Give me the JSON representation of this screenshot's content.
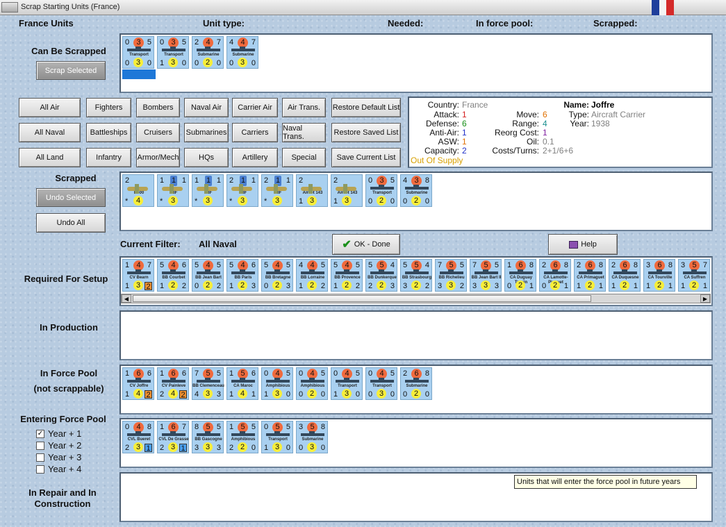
{
  "window": {
    "title": "Scrap Starting Units (France)"
  },
  "flag_colors": [
    "#1f3f9c",
    "#f4f4f4",
    "#d42a2a"
  ],
  "header": {
    "france_units": "France Units",
    "unit_type": "Unit type:",
    "needed": "Needed:",
    "in_force_pool": "In force pool:",
    "scrapped": "Scrapped:"
  },
  "sections": {
    "can_be_scrapped": "Can Be Scrapped",
    "scrapped": "Scrapped",
    "current_filter_label": "Current Filter:",
    "current_filter_value": "All Naval",
    "required": "Required For Setup",
    "in_production": "In Production",
    "in_force_pool_1": "In Force Pool",
    "in_force_pool_2": "(not scrappable)",
    "entering": "Entering Force Pool",
    "repair_1": "In Repair and In",
    "repair_2": "Construction"
  },
  "buttons": {
    "scrap_selected": "Scrap Selected",
    "undo_selected": "Undo Selected",
    "undo_all": "Undo All",
    "ok_done": "OK - Done",
    "help": "Help"
  },
  "filters": [
    [
      "All Air",
      "Fighters",
      "Bombers",
      "Naval Air",
      "Carrier Air",
      "Air Trans.",
      "Restore Default List"
    ],
    [
      "All Naval",
      "Battleships",
      "Cruisers",
      "Submarines",
      "Carriers",
      "Naval Trans.",
      "Restore Saved List"
    ],
    [
      "All Land",
      "Infantry",
      "Armor/Mech",
      "HQs",
      "Artillery",
      "Special",
      "Save Current List"
    ]
  ],
  "info": {
    "country_k": "Country:",
    "country_v": "France",
    "attack_k": "Attack:",
    "attack_v": "1",
    "defense_k": "Defense:",
    "defense_v": "6",
    "antiair_k": "Anti-Air:",
    "antiair_v": "1",
    "asw_k": "ASW:",
    "asw_v": "1",
    "capacity_k": "Capacity:",
    "capacity_v": "2",
    "supply": "Out Of Supply",
    "move_k": "Move:",
    "move_v": "6",
    "range_k": "Range:",
    "range_v": "4",
    "reorg_k": "Reorg Cost:",
    "reorg_v": "1",
    "oil_k": "Oil:",
    "oil_v": "0.1",
    "costs_k": "Costs/Turns:",
    "costs_v": "2+1/6+6",
    "name_k": "Name:",
    "name_v": "Joffre",
    "type_k": "Type:",
    "type_v": "Aircraft Carrier",
    "year_k": "Year:",
    "year_v": "1938"
  },
  "entering_checks": [
    {
      "label": "Year + 1",
      "checked": "✓"
    },
    {
      "label": "Year + 2",
      "checked": ""
    },
    {
      "label": "Year + 3",
      "checked": ""
    },
    {
      "label": "Year + 4",
      "checked": ""
    }
  ],
  "tooltip": "Units that will enter the force pool in future years",
  "can_scrap": [
    {
      "tl": "0",
      "tc": "3",
      "tr": "5",
      "nm": "Transport",
      "bl": "0",
      "bc": "3",
      "br": "0"
    },
    {
      "tl": "0",
      "tc": "3",
      "tr": "5",
      "nm": "Transport",
      "bl": "1",
      "bc": "3",
      "br": "0"
    },
    {
      "tl": "2",
      "tc": "4",
      "tr": "7",
      "nm": "Submarine",
      "bl": "0",
      "bc": "2",
      "br": "0"
    },
    {
      "tl": "4",
      "tc": "4",
      "tr": "7",
      "nm": "Submarine",
      "bl": "0",
      "bc": "3",
      "br": "0"
    }
  ],
  "scrapped_units": [
    {
      "tl": "2",
      "tc": "",
      "tr": "",
      "nm": "D500",
      "bl": "*",
      "bc": "4",
      "br": "",
      "air": true
    },
    {
      "tl": "1",
      "tc": "1",
      "tr": "1",
      "nm": "F3F",
      "bl": "*",
      "bc": "3",
      "br": "",
      "air": true
    },
    {
      "tl": "1",
      "tc": "1",
      "tr": "1",
      "nm": "F3F",
      "bl": "*",
      "bc": "3",
      "br": "",
      "air": true
    },
    {
      "tl": "2",
      "tc": "1",
      "tr": "1",
      "nm": "F3F",
      "bl": "*",
      "bc": "3",
      "br": "",
      "air": true
    },
    {
      "tl": "2",
      "tc": "1",
      "tr": "1",
      "nm": "F3F",
      "bl": "*",
      "bc": "3",
      "br": "",
      "air": true
    },
    {
      "tl": "2",
      "tc": "",
      "tr": "",
      "nm": "Amiot 143",
      "bl": "1",
      "bc": "3",
      "br": "",
      "air": true
    },
    {
      "tl": "2",
      "tc": "",
      "tr": "",
      "nm": "Amiot 143",
      "bl": "1",
      "bc": "3",
      "br": "",
      "air": true
    },
    {
      "tl": "0",
      "tc": "3",
      "tr": "5",
      "nm": "Transport",
      "bl": "0",
      "bc": "2",
      "br": "0"
    },
    {
      "tl": "4",
      "tc": "3",
      "tr": "8",
      "nm": "Submarine",
      "bl": "0",
      "bc": "2",
      "br": "0"
    }
  ],
  "required": [
    {
      "tl": "1",
      "tc": "4",
      "tr": "7",
      "nm": "CV Bearn",
      "bl": "1",
      "bc": "3",
      "bs": "2"
    },
    {
      "tl": "5",
      "tc": "4",
      "tr": "6",
      "nm": "BB Courbet",
      "bl": "1",
      "bc": "2",
      "br": "2"
    },
    {
      "tl": "5",
      "tc": "4",
      "tr": "5",
      "nm": "BB Jean Bart",
      "bl": "0",
      "bc": "2",
      "br": "2"
    },
    {
      "tl": "5",
      "tc": "4",
      "tr": "6",
      "nm": "BB Paris",
      "bl": "1",
      "bc": "2",
      "br": "3"
    },
    {
      "tl": "5",
      "tc": "4",
      "tr": "5",
      "nm": "BB Bretagne",
      "bl": "0",
      "bc": "2",
      "br": "3"
    },
    {
      "tl": "4",
      "tc": "4",
      "tr": "5",
      "nm": "BB Lorraine",
      "bl": "1",
      "bc": "2",
      "br": "2"
    },
    {
      "tl": "5",
      "tc": "4",
      "tr": "5",
      "nm": "BB Provence",
      "bl": "1",
      "bc": "2",
      "br": "2"
    },
    {
      "tl": "5",
      "tc": "5",
      "tr": "4",
      "nm": "BB Dunkerque",
      "bl": "2",
      "bc": "2",
      "br": "3"
    },
    {
      "tl": "5",
      "tc": "5",
      "tr": "4",
      "nm": "BB Strasbourg",
      "bl": "3",
      "bc": "2",
      "br": "2"
    },
    {
      "tl": "7",
      "tc": "5",
      "tr": "5",
      "nm": "BB Richelieu",
      "bl": "3",
      "bc": "3",
      "br": "2"
    },
    {
      "tl": "7",
      "tc": "5",
      "tr": "5",
      "nm": "BB Jean Bart II",
      "bl": "3",
      "bc": "3",
      "br": "3"
    },
    {
      "tl": "1",
      "tc": "6",
      "tr": "8",
      "nm": "CA Duguay Trouin",
      "bl": "0",
      "bc": "2",
      "br": "1"
    },
    {
      "tl": "2",
      "tc": "6",
      "tr": "8",
      "nm": "CA Lamotte-Picquet",
      "bl": "0",
      "bc": "2",
      "br": "1"
    },
    {
      "tl": "2",
      "tc": "6",
      "tr": "8",
      "nm": "CA Primaguet",
      "bl": "1",
      "bc": "2",
      "br": "1"
    },
    {
      "tl": "2",
      "tc": "6",
      "tr": "8",
      "nm": "CA Duquesne",
      "bl": "1",
      "bc": "2",
      "br": "1"
    },
    {
      "tl": "3",
      "tc": "6",
      "tr": "8",
      "nm": "CA Tourville",
      "bl": "1",
      "bc": "2",
      "br": "1"
    },
    {
      "tl": "3",
      "tc": "5",
      "tr": "7",
      "nm": "CA Suffren",
      "bl": "1",
      "bc": "2",
      "br": "1"
    }
  ],
  "force_pool": [
    {
      "tl": "1",
      "tc": "6",
      "tr": "6",
      "nm": "CV Joffre",
      "bl": "1",
      "bc": "4",
      "bs": "2"
    },
    {
      "tl": "1",
      "tc": "6",
      "tr": "6",
      "nm": "CV Painleve",
      "bl": "2",
      "bc": "4",
      "bs": "2"
    },
    {
      "tl": "7",
      "tc": "5",
      "tr": "5",
      "nm": "BB Clemenceau",
      "bl": "4",
      "bc": "3",
      "br": "3"
    },
    {
      "tl": "1",
      "tc": "5",
      "tr": "6",
      "nm": "CA Maroc",
      "bl": "1",
      "bc": "4",
      "br": "1"
    },
    {
      "tl": "0",
      "tc": "4",
      "tr": "5",
      "nm": "Amphibious",
      "bl": "1",
      "bc": "3",
      "br": "0"
    },
    {
      "tl": "0",
      "tc": "4",
      "tr": "5",
      "nm": "Amphibious",
      "bl": "0",
      "bc": "2",
      "br": "0"
    },
    {
      "tl": "0",
      "tc": "4",
      "tr": "5",
      "nm": "Transport",
      "bl": "1",
      "bc": "3",
      "br": "0"
    },
    {
      "tl": "0",
      "tc": "4",
      "tr": "5",
      "nm": "Transport",
      "bl": "0",
      "bc": "3",
      "br": "0"
    },
    {
      "tl": "2",
      "tc": "6",
      "tr": "8",
      "nm": "Submarine",
      "bl": "0",
      "bc": "2",
      "br": "0"
    }
  ],
  "entering_units": [
    {
      "tl": "0",
      "tc": "4",
      "tr": "8",
      "nm": "CVL Bueret",
      "bl": "2",
      "bc": "3",
      "bs": "1"
    },
    {
      "tl": "1",
      "tc": "6",
      "tr": "7",
      "nm": "CVL De Grasse",
      "bl": "2",
      "bc": "3",
      "bs": "1"
    },
    {
      "tl": "8",
      "tc": "5",
      "tr": "5",
      "nm": "BB Gascogne",
      "bl": "3",
      "bc": "3",
      "br": "3"
    },
    {
      "tl": "1",
      "tc": "5",
      "tr": "5",
      "nm": "Amphibious",
      "bl": "2",
      "bc": "2",
      "br": "0"
    },
    {
      "tl": "0",
      "tc": "5",
      "tr": "5",
      "nm": "Transport",
      "bl": "1",
      "bc": "3",
      "br": "0"
    },
    {
      "tl": "3",
      "tc": "5",
      "tr": "8",
      "nm": "Submarine",
      "bl": "0",
      "bc": "3",
      "br": "0"
    }
  ]
}
